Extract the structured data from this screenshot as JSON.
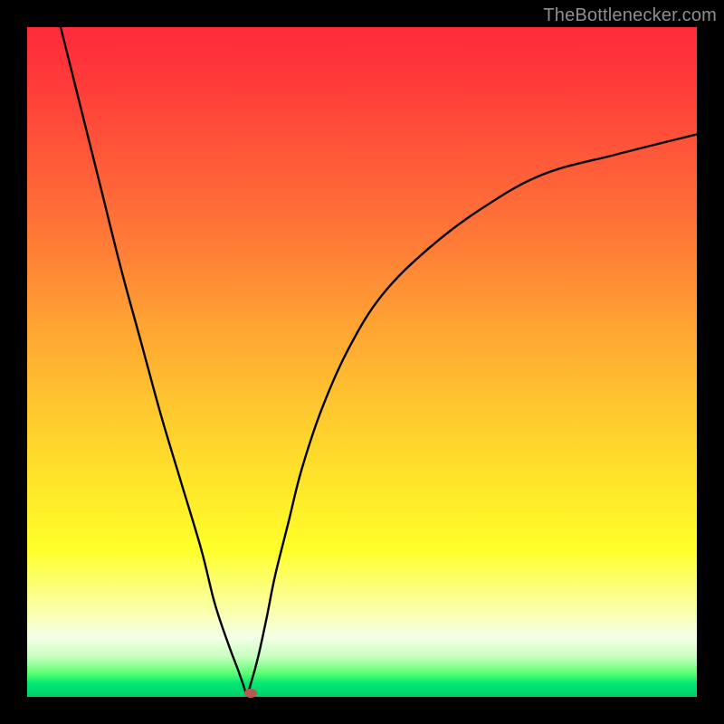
{
  "attribution": "TheBottlenecker.com",
  "gradient": {
    "top": "#ff2a3a",
    "mid": "#ffe52a",
    "bottom": "#00cf6a"
  },
  "chart_data": {
    "type": "line",
    "title": "",
    "xlabel": "",
    "ylabel": "",
    "xlim": [
      0,
      100
    ],
    "ylim": [
      0,
      100
    ],
    "x": [
      5,
      8,
      11,
      14,
      17,
      20,
      23,
      26,
      28,
      30,
      31.5,
      32.2,
      32.8,
      33.4,
      34.5,
      35.8,
      37,
      39,
      41,
      44,
      48,
      53,
      60,
      68,
      77,
      88,
      100
    ],
    "values": [
      100,
      88,
      76,
      64,
      53,
      42,
      32,
      22,
      14,
      8,
      4,
      2,
      0.5,
      2,
      6,
      12,
      18,
      26,
      34,
      43,
      52,
      60,
      67,
      73,
      78,
      81,
      84
    ],
    "annotations": [
      {
        "label": "minimum-marker",
        "x": 33.4,
        "y": 0.5
      }
    ]
  }
}
